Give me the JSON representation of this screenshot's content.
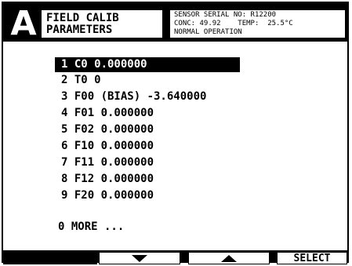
{
  "header": {
    "page_letter": "A",
    "title_line1": "FIELD CALIB",
    "title_line2": "PARAMETERS",
    "status": {
      "line1": "SENSOR SERIAL NO: R12200",
      "line2": "CONC: 49.92    TEMP:  25.5°C",
      "line3": "NORMAL OPERATION"
    }
  },
  "menu": {
    "items": [
      {
        "label": "1 C0 0.000000",
        "selected": true
      },
      {
        "label": "2 T0 0",
        "selected": false
      },
      {
        "label": "3 F00 (BIAS) -3.640000",
        "selected": false
      },
      {
        "label": "4 F01 0.000000",
        "selected": false
      },
      {
        "label": "5 F02 0.000000",
        "selected": false
      },
      {
        "label": "6 F10 0.000000",
        "selected": false
      },
      {
        "label": "7 F11 0.000000",
        "selected": false
      },
      {
        "label": "8 F12 0.000000",
        "selected": false
      },
      {
        "label": "9 F20 0.000000",
        "selected": false
      }
    ],
    "more_label": "0 MORE ..."
  },
  "softkeys": {
    "key1_label": "",
    "key2_icon": "arrow-down-icon",
    "key3_icon": "arrow-up-icon",
    "key4_label": "SELECT"
  },
  "colors": {
    "foreground": "#000000",
    "background": "#ffffff"
  }
}
